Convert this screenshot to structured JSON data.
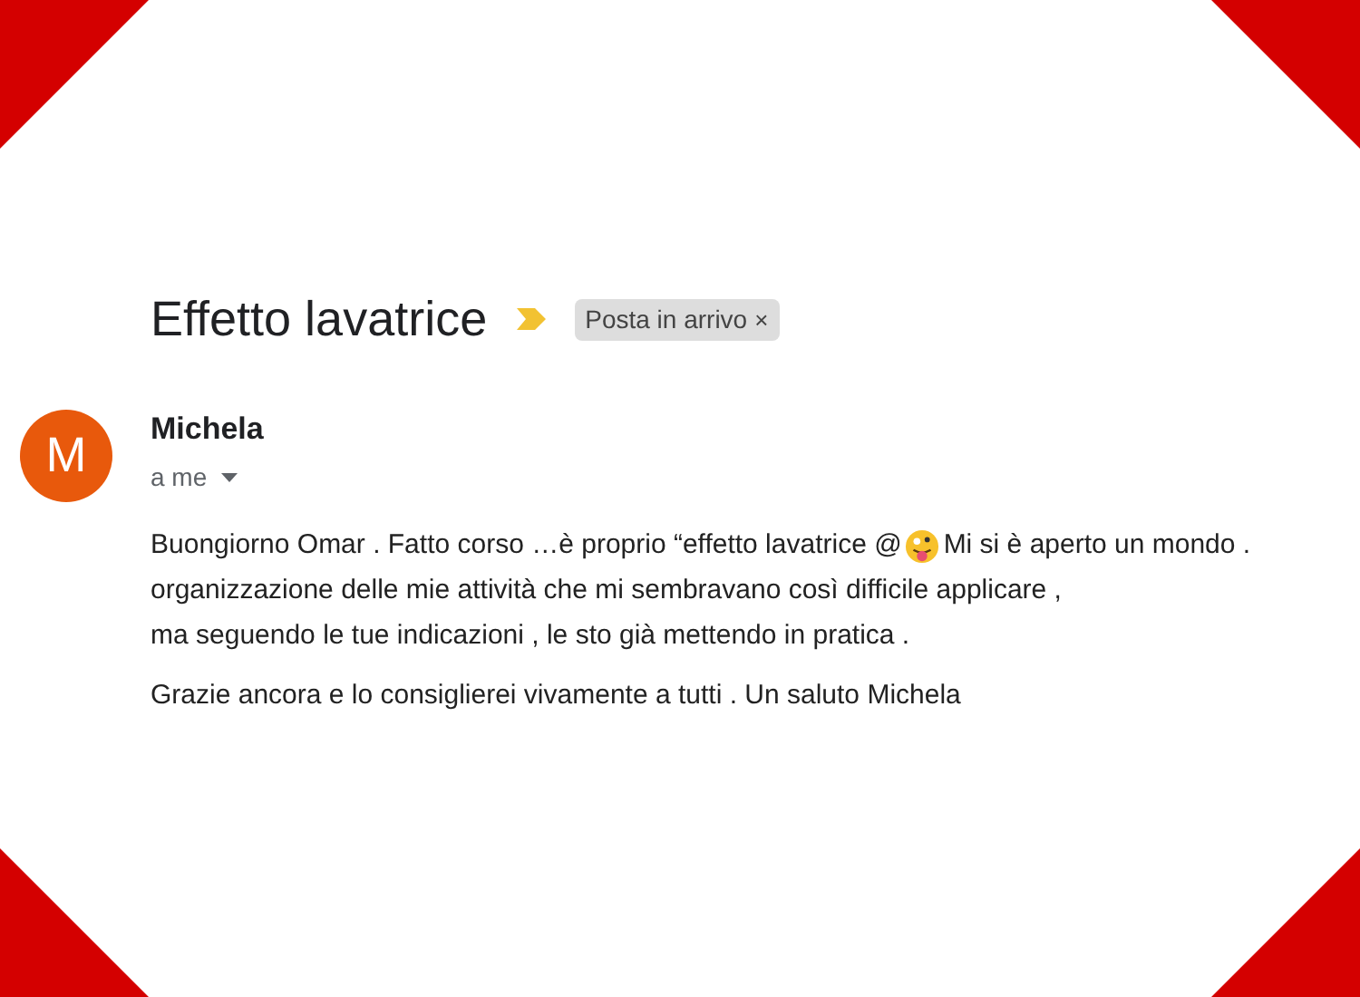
{
  "subject": "Effetto lavatrice",
  "label": {
    "text": "Posta in arrivo",
    "close": "×"
  },
  "sender": {
    "initial": "M",
    "name": "Michela",
    "recipient": "a me"
  },
  "body": [
    {
      "segments": [
        {
          "kind": "text",
          "text": "Buongiorno Omar . Fatto corso …è proprio “effetto lavatrice @"
        },
        {
          "kind": "emoji"
        },
        {
          "kind": "text",
          "text": "Mi si è aperto un mondo ."
        }
      ]
    },
    {
      "segments": [
        {
          "kind": "text",
          "text": "organizzazione delle mie attività che mi sembravano così difficile applicare ,"
        }
      ]
    },
    {
      "segments": [
        {
          "kind": "text",
          "text": "ma seguendo le tue indicazioni , le sto già mettendo in pratica ."
        }
      ]
    },
    {
      "segments": [
        {
          "kind": "text",
          "text": "Grazie ancora e lo consiglierei vivamente a tutti . Un saluto Michela"
        }
      ]
    }
  ]
}
